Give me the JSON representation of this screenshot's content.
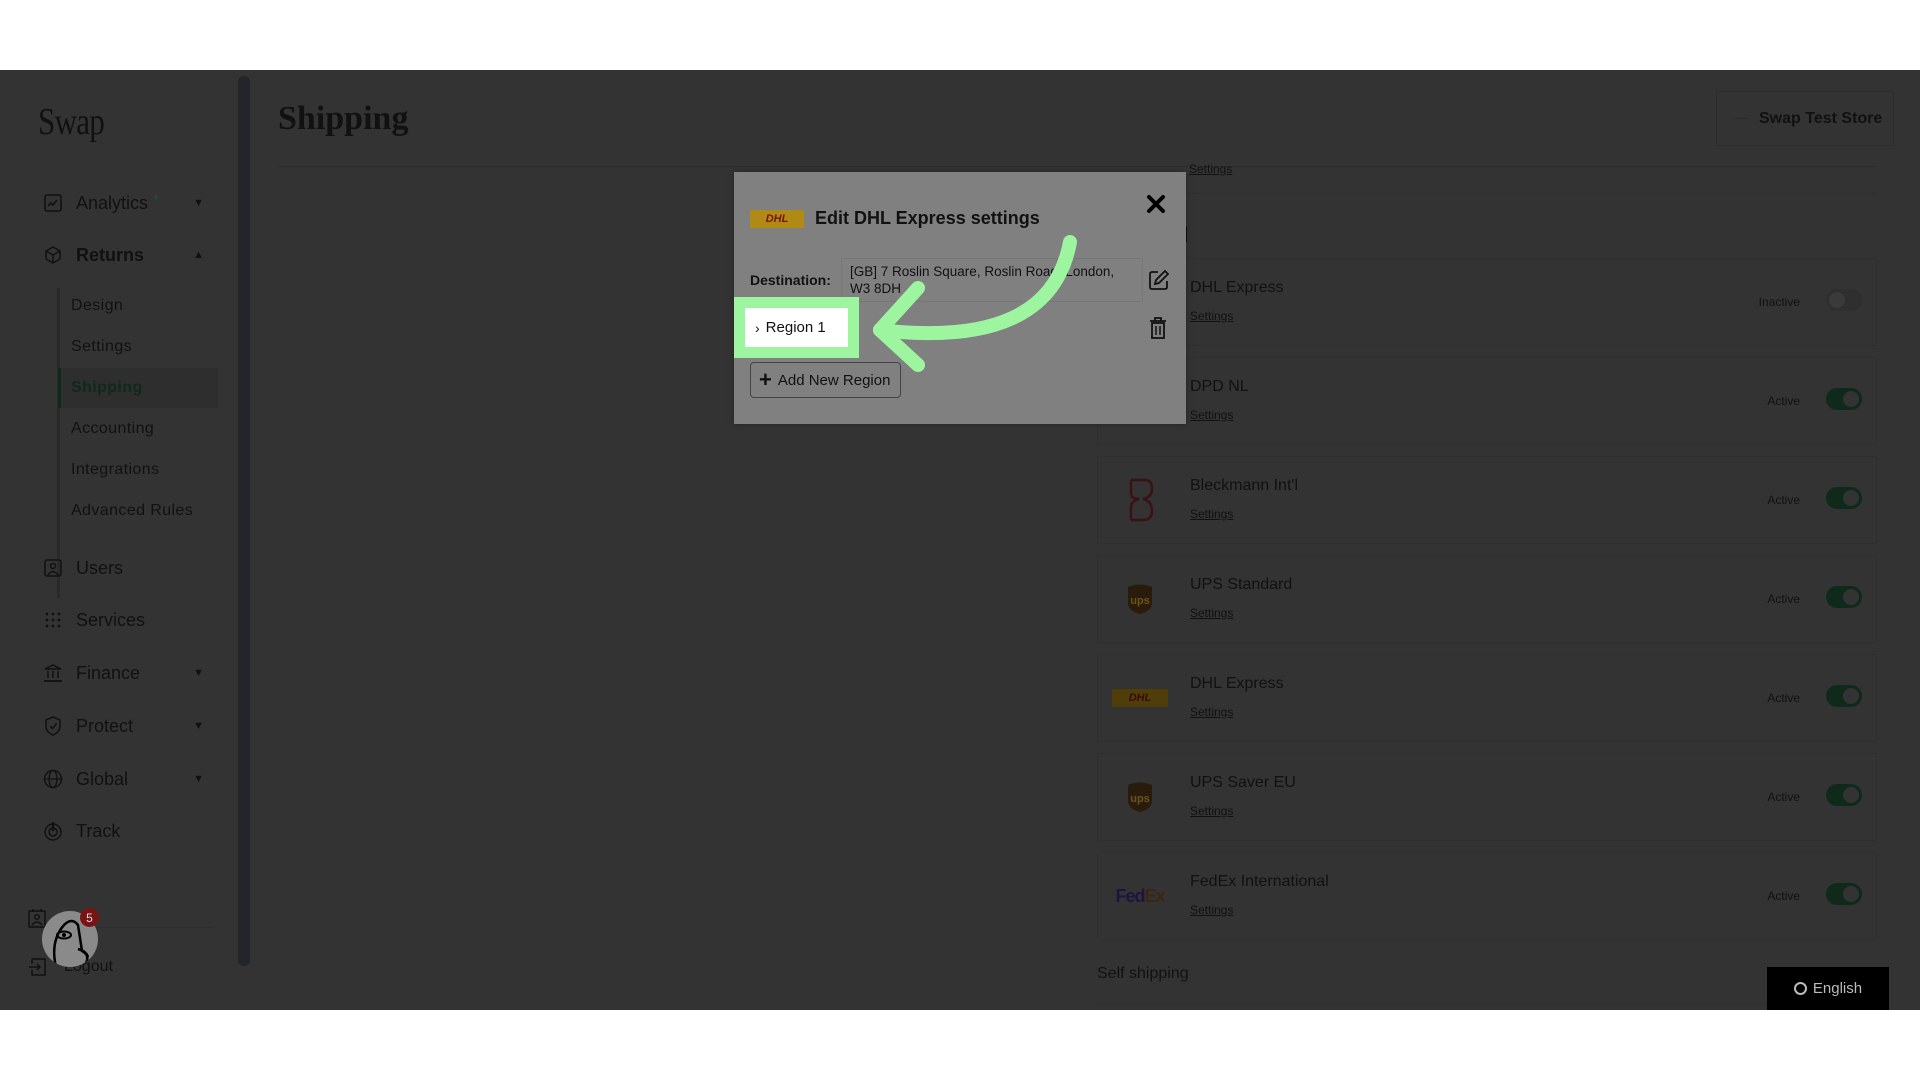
{
  "sidebar": {
    "logo": "Swap",
    "items": [
      {
        "label": "Analytics",
        "icon": "chart-icon",
        "caret": "▼"
      },
      {
        "label": "Returns",
        "icon": "box-icon",
        "caret": "▲"
      },
      {
        "label": "Users",
        "icon": "user-icon"
      },
      {
        "label": "Services",
        "icon": "grid-dots-icon"
      },
      {
        "label": "Finance",
        "icon": "bank-icon",
        "caret": "▼"
      },
      {
        "label": "Protect",
        "icon": "shield-icon",
        "caret": "▼"
      },
      {
        "label": "Global",
        "icon": "globe-icon",
        "caret": "▼"
      },
      {
        "label": "Track",
        "icon": "track-icon"
      }
    ],
    "returns_sub": [
      "Design",
      "Settings",
      "Shipping",
      "Accounting",
      "Integrations",
      "Advanced Rules"
    ],
    "active_sub": "Shipping",
    "footer": {
      "logout": "Logout",
      "notification_count": "5"
    }
  },
  "header": {
    "title": "Shipping",
    "store": "Swap Test Store"
  },
  "carriers": [
    {
      "name": "DHL Express",
      "settings": "Settings",
      "status": "Inactive",
      "active": false,
      "logo": "DHL"
    },
    {
      "name": "DPD NL",
      "settings": "Settings",
      "status": "Active",
      "active": true,
      "logo": ""
    },
    {
      "name": "Bleckmann Int'l",
      "settings": "Settings",
      "status": "Active",
      "active": true,
      "logo": "B"
    },
    {
      "name": "UPS Standard",
      "settings": "Settings",
      "status": "Active",
      "active": true,
      "logo": "ups"
    },
    {
      "name": "DHL Express",
      "settings": "Settings",
      "status": "Active",
      "active": true,
      "logo": "DHL"
    },
    {
      "name": "UPS Saver EU",
      "settings": "Settings",
      "status": "Active",
      "active": true,
      "logo": "ups"
    },
    {
      "name": "FedEx International",
      "settings": "Settings",
      "status": "Active",
      "active": true,
      "logo": "FedEx"
    }
  ],
  "partial_settings": "Settings",
  "self_shipping_heading": "Self shipping",
  "language": "English",
  "modal": {
    "title": "Edit DHL Express settings",
    "logo_text": "DHL",
    "destination_label": "Destination:",
    "destination_value": "[GB] 7 Roslin Square, Roslin Road, London, W3 8DH",
    "region": "Region 1",
    "add_region": "Add New Region"
  },
  "colors": {
    "highlight": "#9ef5a0",
    "toggle_active": "#0f2a1b",
    "dhl_yellow": "#b08a14",
    "badge": "#7a1414"
  }
}
